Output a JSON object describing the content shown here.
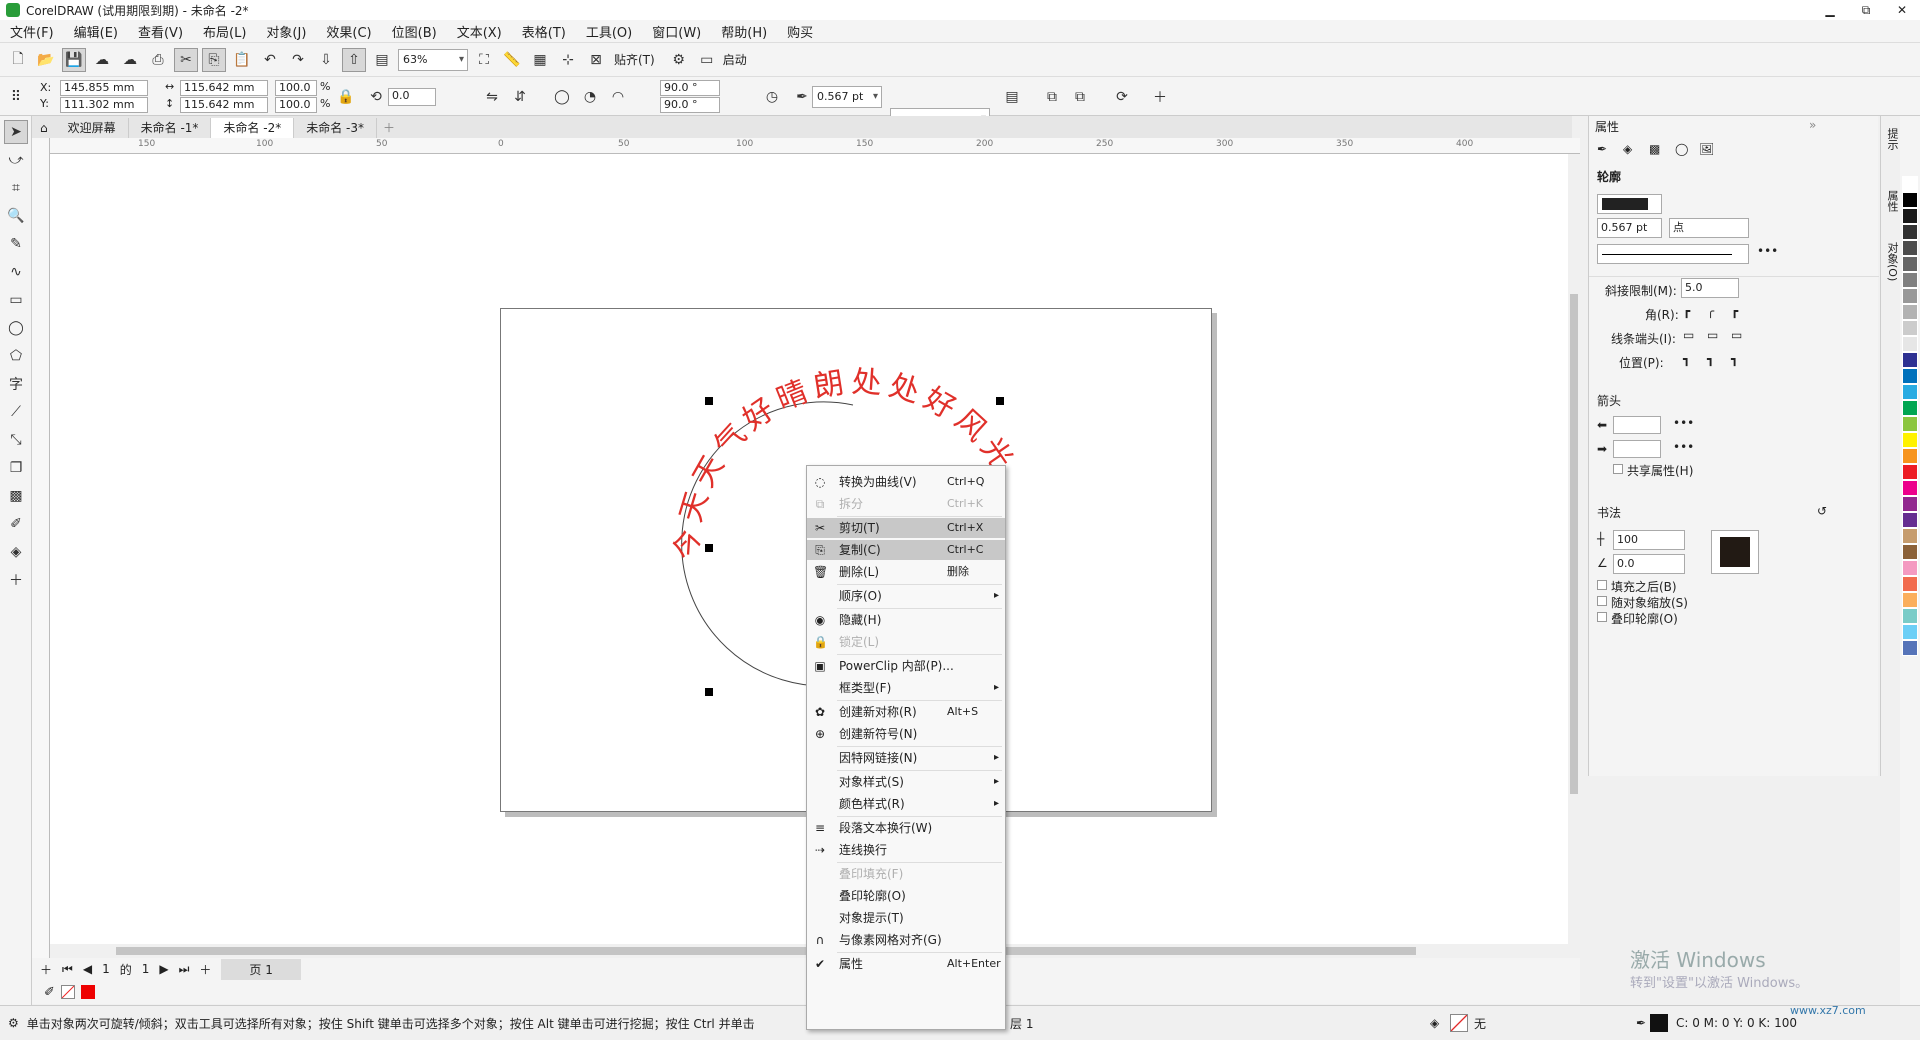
{
  "window": {
    "title": "CorelDRAW (试用期限到期) - 未命名 -2*",
    "min": "▁",
    "max": "⧉",
    "close": "✕"
  },
  "menu": [
    "文件(F)",
    "编辑(E)",
    "查看(V)",
    "布局(L)",
    "对象(J)",
    "效果(C)",
    "位图(B)",
    "文本(X)",
    "表格(T)",
    "工具(O)",
    "窗口(W)",
    "帮助(H)",
    "购买"
  ],
  "toolbar": {
    "zoom": "63%",
    "snap_label": "贴齐(T)",
    "launch_label": "启动"
  },
  "propbar": {
    "x": "145.855 mm",
    "y": "111.302 mm",
    "w": "115.642 mm",
    "h": "115.642 mm",
    "scale_x": "100.0",
    "scale_y": "100.0",
    "pct": "%",
    "rotation": "0.0",
    "angle1": "90.0 °",
    "angle2": "90.0 °",
    "outline_width": "0.567 pt"
  },
  "tabs": [
    "欢迎屏幕",
    "未命名 -1*",
    "未命名 -2*",
    "未命名 -3*"
  ],
  "ruler_labels": [
    "150",
    "100",
    "50",
    "0",
    "50",
    "100",
    "150",
    "200",
    "250",
    "300",
    "350",
    "400"
  ],
  "artwork": {
    "path_text": "今天天气好晴朗处处好风光",
    "color": "#e0302a"
  },
  "pagenav": {
    "current": "1",
    "of": "的",
    "total": "1",
    "page_tab": "页 1"
  },
  "status": {
    "hint": "单击对象两次可旋转/倾斜；双击工具可选择所有对象；按住 Shift 键单击可选择多个对象；按住 Alt 键单击可进行挖掘；按住 Ctrl 并单击",
    "layer": "层 1",
    "fill": "无",
    "cmyk": "C: 0 M: 0 Y: 0 K: 100"
  },
  "props": {
    "header": "属性",
    "outline_title": "轮廓",
    "width": "0.567 pt",
    "unit": "点",
    "miter_label": "斜接限制(M):",
    "miter_value": "5.0",
    "corner_label": "角(R):",
    "cap_label": "线条端头(I):",
    "pos_label": "位置(P):",
    "arrow_title": "箭头",
    "share_attr": "共享属性(H)",
    "calligraphy_title": "书法",
    "stretch": "100",
    "angle": "0.0",
    "opt1": "填充之后(B)",
    "opt2": "随对象缩放(S)",
    "opt3": "叠印轮廓(O)"
  },
  "sidetabs": [
    "提示",
    "属性",
    "对象(O)"
  ],
  "palette": [
    "#ffffff",
    "#000000",
    "#1a1a1a",
    "#333333",
    "#4d4d4d",
    "#666666",
    "#808080",
    "#999999",
    "#b3b3b3",
    "#cccccc",
    "#e6e6e6",
    "#2e3192",
    "#0071bc",
    "#29abe2",
    "#00a651",
    "#8cc63f",
    "#fff200",
    "#f7941d",
    "#ed1c24",
    "#ec008c",
    "#92278f",
    "#662d91",
    "#c69c6d",
    "#8c6239",
    "#f49ac1",
    "#f26c4f",
    "#fbaf5d",
    "#7accc8",
    "#6dcff6",
    "#5674b9"
  ],
  "context_menu": [
    {
      "label": "转换为曲线(V)",
      "shortcut": "Ctrl+Q",
      "icon": "convert-curve-icon",
      "glyph": "◌"
    },
    {
      "label": "拆分",
      "shortcut": "Ctrl+K",
      "icon": "break-apart-icon",
      "glyph": "⧉",
      "disabled": true
    },
    {
      "label": "剪切(T)",
      "shortcut": "Ctrl+X",
      "icon": "cut-icon",
      "glyph": "✂",
      "highlight": true
    },
    {
      "label": "复制(C)",
      "shortcut": "Ctrl+C",
      "icon": "copy-icon",
      "glyph": "⎘",
      "highlight": true
    },
    {
      "label": "删除(L)",
      "shortcut": "删除",
      "icon": "trash-icon",
      "glyph": "🗑"
    },
    {
      "label": "顺序(O)",
      "arrow": true
    },
    {
      "label": "隐藏(H)",
      "icon": "eye-icon",
      "glyph": "◉"
    },
    {
      "label": "锁定(L)",
      "icon": "lock-icon",
      "glyph": "🔒",
      "disabled": true
    },
    {
      "label": "PowerClip 内部(P)...",
      "icon": "powerclip-icon",
      "glyph": "▣"
    },
    {
      "label": "框类型(F)",
      "arrow": true
    },
    {
      "label": "创建新对称(R)",
      "shortcut": "Alt+S",
      "icon": "symmetry-icon",
      "glyph": "✿"
    },
    {
      "label": "创建新符号(N)",
      "icon": "symbol-icon",
      "glyph": "⊕"
    },
    {
      "label": "因特网链接(N)",
      "arrow": true
    },
    {
      "label": "对象样式(S)",
      "arrow": true
    },
    {
      "label": "颜色样式(R)",
      "arrow": true
    },
    {
      "label": "段落文本换行(W)",
      "icon": "text-wrap-icon",
      "glyph": "≡"
    },
    {
      "label": "连线换行",
      "icon": "connector-wrap-icon",
      "glyph": "⇢"
    },
    {
      "label": "叠印填充(F)",
      "disabled": true
    },
    {
      "label": "叠印轮廓(O)"
    },
    {
      "label": "对象提示(T)"
    },
    {
      "label": "与像素网格对齐(G)",
      "icon": "magnet-icon",
      "glyph": "∩"
    },
    {
      "label": "属性",
      "shortcut": "Alt+Enter",
      "icon": "checkmark-icon",
      "glyph": "✔"
    }
  ],
  "watermark": {
    "line1": "激活 Windows",
    "line2": "转到\"设置\"以激活 Windows。",
    "site": "www.xz7.com"
  }
}
